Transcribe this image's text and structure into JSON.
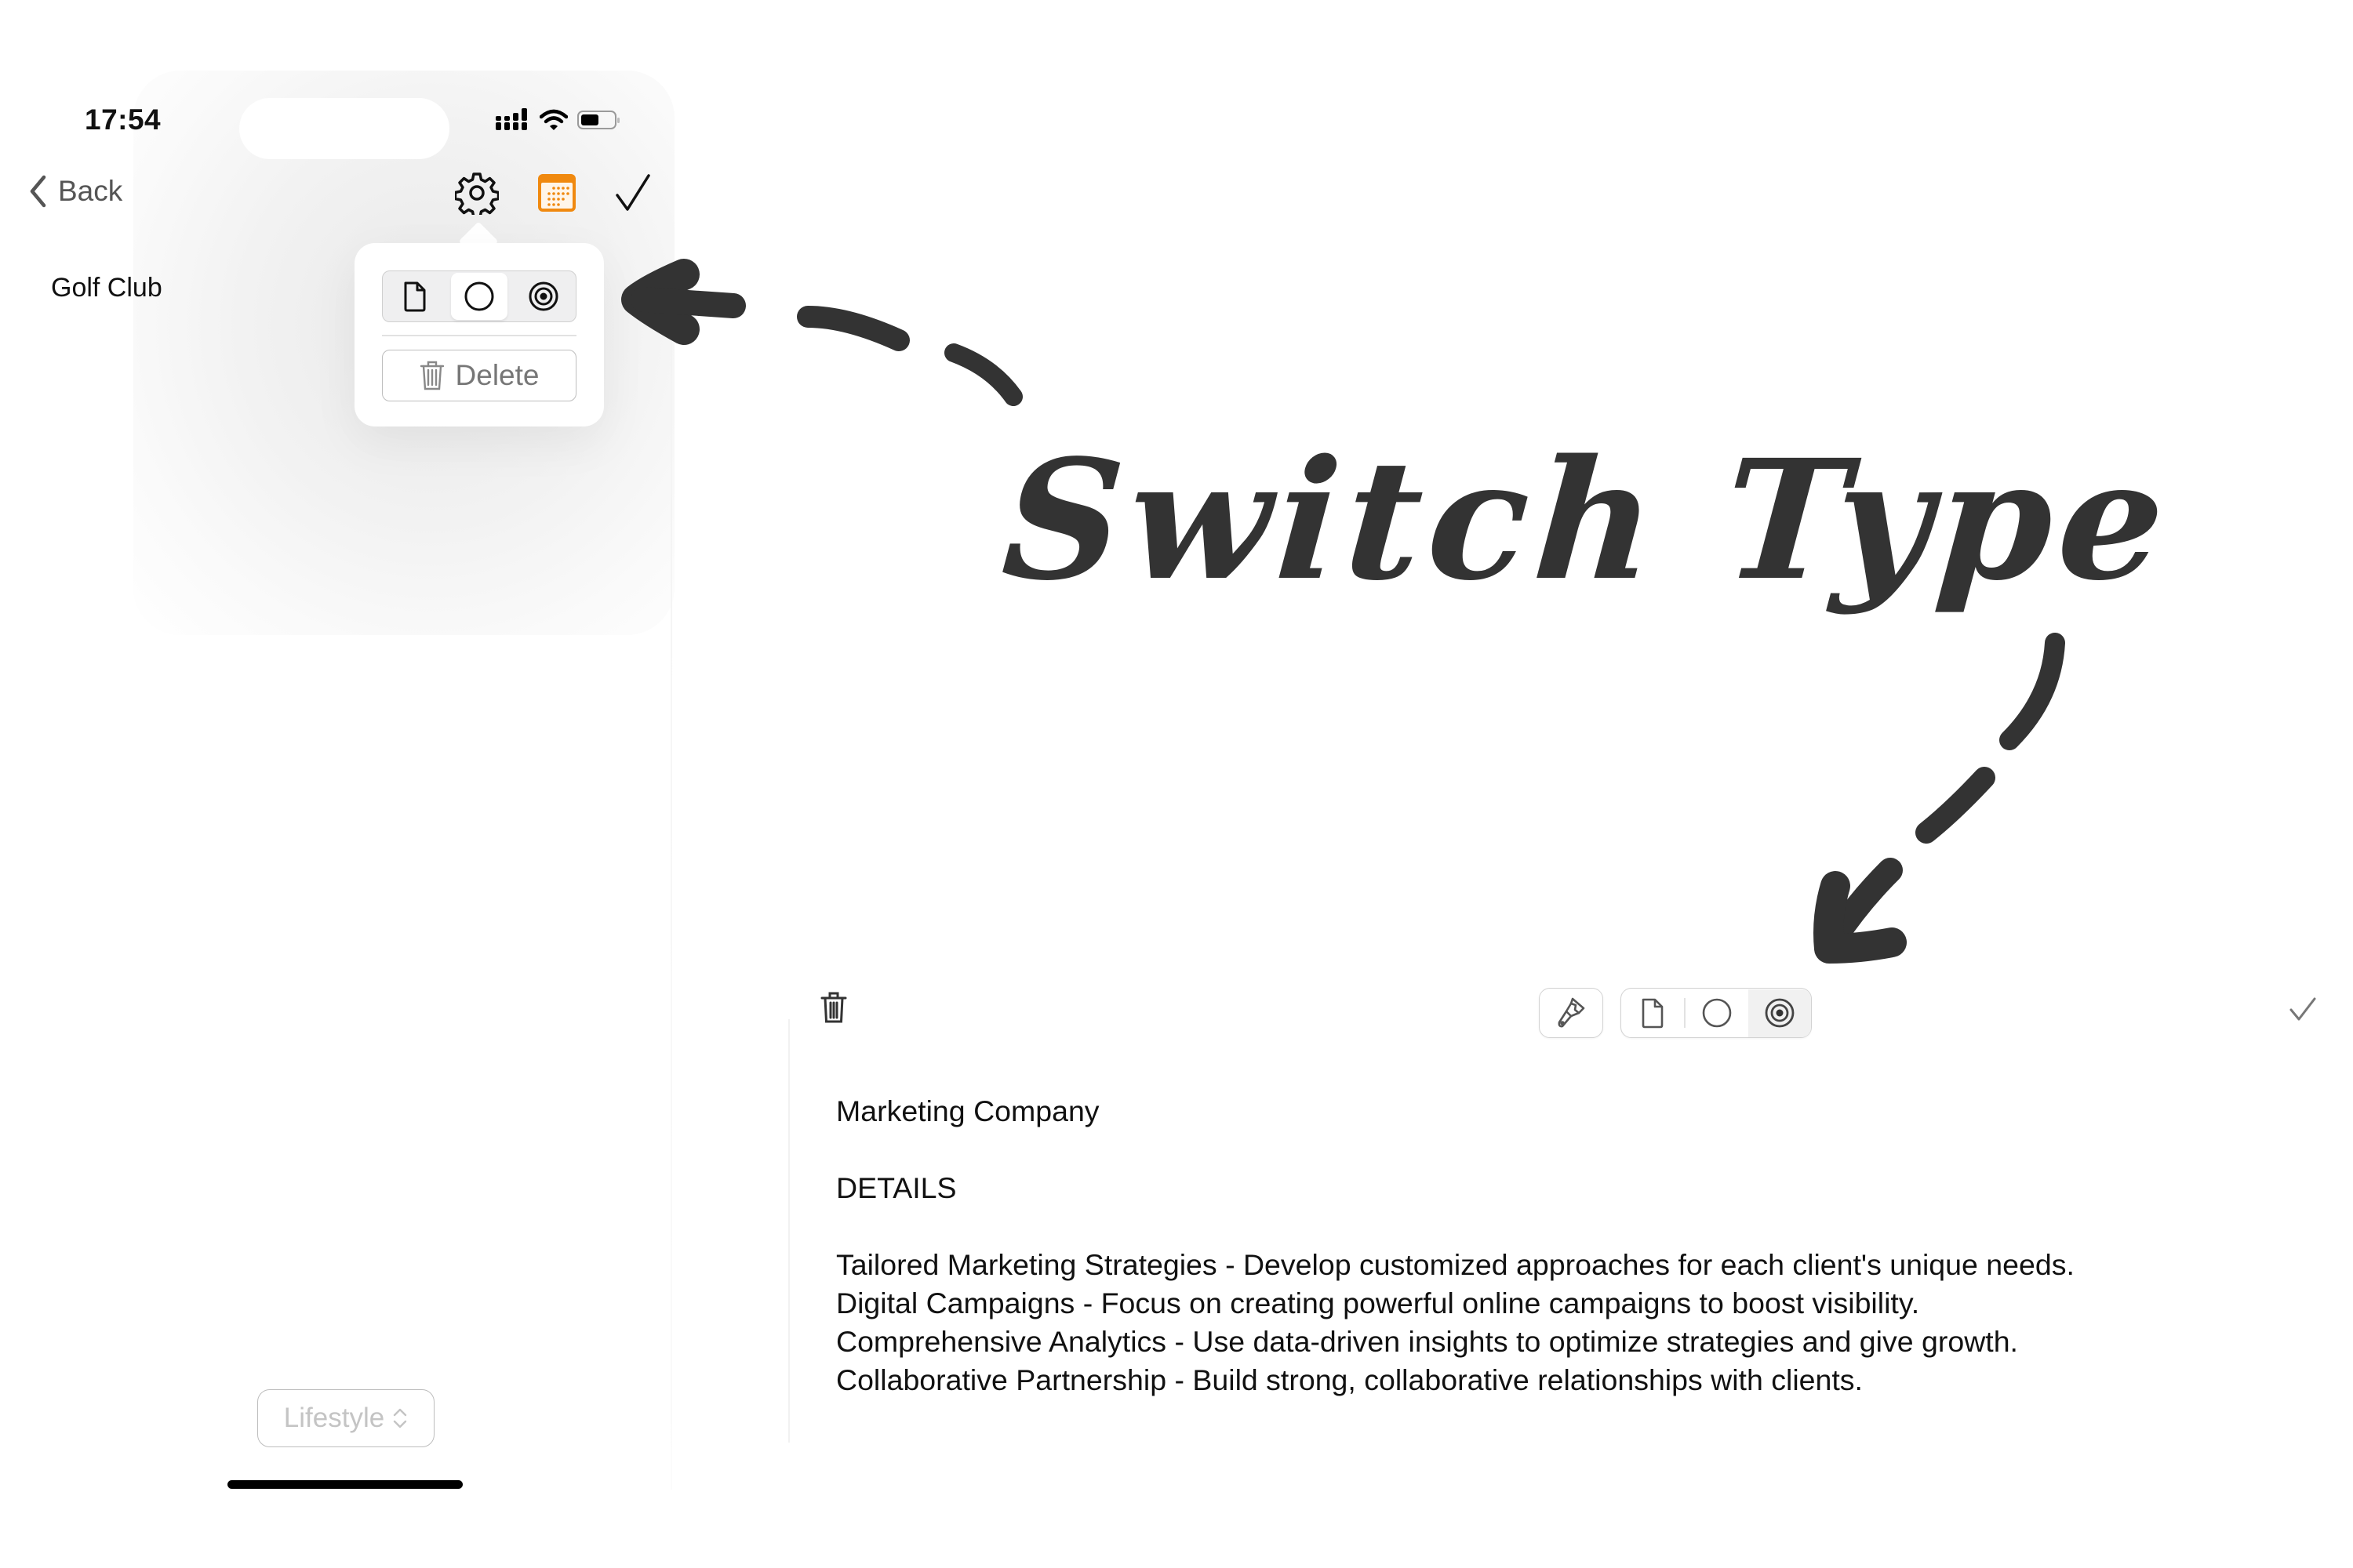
{
  "phone": {
    "status_bar": {
      "time": "17:54",
      "icons": [
        "cellular-signal-icon",
        "wifi-icon",
        "battery-icon"
      ]
    },
    "nav": {
      "back_label": "Back",
      "icons": [
        "gear-icon",
        "calendar-icon",
        "checkmark-icon"
      ],
      "accent_color": "#F0890F"
    },
    "note_title": "Golf Club",
    "popover": {
      "type_options": [
        {
          "icon": "document-icon",
          "selected": false
        },
        {
          "icon": "circle-icon",
          "selected": true
        },
        {
          "icon": "target-icon",
          "selected": false
        }
      ],
      "delete_label": "Delete"
    },
    "category_picker": {
      "label": "Lifestyle",
      "icon": "chevron-up-down-icon"
    }
  },
  "annotation": {
    "text": "Switch Type",
    "color": "#333333"
  },
  "editor": {
    "toolbar": {
      "left_icon": "trash-icon",
      "style_icon": "paintbrush-icon",
      "type_options": [
        {
          "icon": "document-icon",
          "selected": false
        },
        {
          "icon": "circle-icon",
          "selected": false
        },
        {
          "icon": "target-icon",
          "selected": true
        }
      ],
      "right_icon": "checkmark-icon"
    },
    "title": "Marketing Company",
    "section_heading": "DETAILS",
    "lines": [
      "Tailored Marketing Strategies - Develop customized approaches for each client's unique needs.",
      "Digital Campaigns - Focus on creating powerful online campaigns to boost visibility.",
      "Comprehensive Analytics - Use data-driven insights to optimize strategies and give growth.",
      "Collaborative Partnership - Build strong, collaborative relationships with clients."
    ]
  }
}
